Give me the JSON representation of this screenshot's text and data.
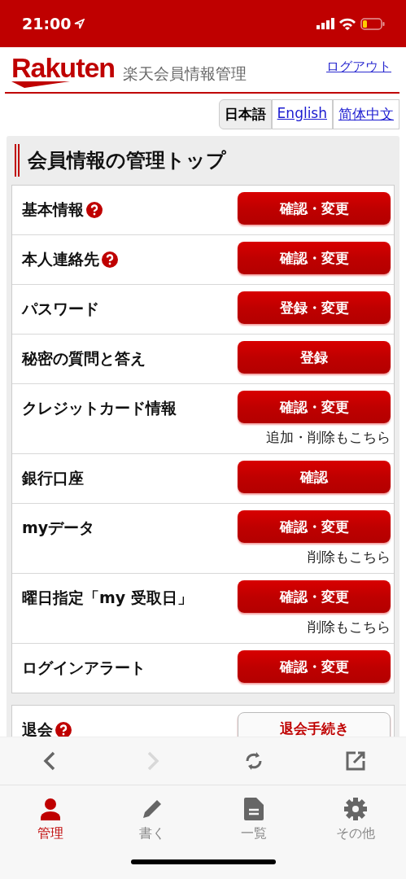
{
  "status_bar": {
    "time": "21:00"
  },
  "header": {
    "logo": "Rakuten",
    "title": "楽天会員情報管理",
    "logout": "ログアウト"
  },
  "languages": [
    {
      "label": "日本語",
      "selected": true
    },
    {
      "label": "English",
      "selected": false
    },
    {
      "label": "简体中文",
      "selected": false
    }
  ],
  "page_title": "会員情報の管理トップ",
  "items": [
    {
      "label": "基本情報",
      "help": true,
      "button": "確認・変更"
    },
    {
      "label": "本人連絡先",
      "help": true,
      "button": "確認・変更"
    },
    {
      "label": "パスワード",
      "help": false,
      "button": "登録・変更"
    },
    {
      "label": "秘密の質問と答え",
      "help": false,
      "button": "登録"
    },
    {
      "label": "クレジットカード情報",
      "help": false,
      "button": "確認・変更",
      "note": "追加・削除もこちら"
    },
    {
      "label": "銀行口座",
      "help": false,
      "button": "確認"
    },
    {
      "label": "myデータ",
      "help": false,
      "button": "確認・変更",
      "note": "削除もこちら"
    },
    {
      "label": "曜日指定「my 受取日」",
      "help": false,
      "button": "確認・変更",
      "note": "削除もこちら"
    },
    {
      "label": "ログインアラート",
      "help": false,
      "button": "確認・変更"
    }
  ],
  "withdraw": {
    "label": "退会",
    "help": true,
    "button": "退会手続き"
  },
  "browser_toolbar": [
    {
      "kind": "back",
      "disabled": false
    },
    {
      "kind": "forward",
      "disabled": true
    },
    {
      "kind": "reload",
      "disabled": false
    },
    {
      "kind": "open",
      "disabled": false
    }
  ],
  "tab_bar": [
    {
      "kind": "person",
      "label": "管理",
      "selected": true
    },
    {
      "kind": "pencil",
      "label": "書く",
      "selected": false
    },
    {
      "kind": "document",
      "label": "一覧",
      "selected": false
    },
    {
      "kind": "gear",
      "label": "その他",
      "selected": false
    }
  ]
}
